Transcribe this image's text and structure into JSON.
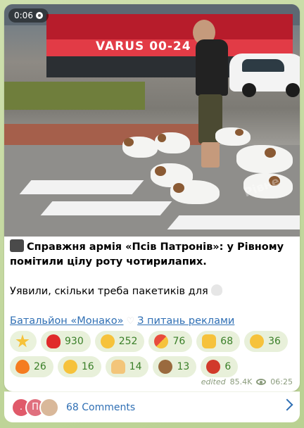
{
  "video": {
    "duration": "0:06",
    "store_sign": "VARUS 00-24",
    "watermark": "Рівне"
  },
  "post": {
    "title": "Справжня армія «Псів Патронів»: у Рівному помітили цілу роту чотирилапих.",
    "body": "Уявили, скільки треба пакетиків для",
    "link1": "Батальйон «Монако»",
    "link2": "З питань реклами"
  },
  "reactions": {
    "row1": [
      {
        "icon": "star-icon",
        "count": "",
        "color": "#f6c23b"
      },
      {
        "icon": "heart-on-fire-icon",
        "count": "930",
        "color": "#e02b2b"
      },
      {
        "icon": "smiling-face-hearts-icon",
        "count": "252",
        "color": "#f6c23b"
      },
      {
        "icon": "pill-icon",
        "count": "76",
        "color": "#e84b3c"
      },
      {
        "icon": "thumbs-up-icon",
        "count": "68",
        "color": "#f6c23b"
      },
      {
        "icon": "screaming-face-icon",
        "count": "36",
        "color": "#f6c23b"
      }
    ],
    "row2": [
      {
        "icon": "fire-icon",
        "count": "26",
        "color": "#f57c1f"
      },
      {
        "icon": "woozy-face-icon",
        "count": "16",
        "color": "#f6c23b"
      },
      {
        "icon": "folded-hands-icon",
        "count": "14",
        "color": "#f3c57a"
      },
      {
        "icon": "see-no-evil-monkey-icon",
        "count": "13",
        "color": "#9a6a3e"
      },
      {
        "icon": "cursing-face-icon",
        "count": "6",
        "color": "#d13a2b"
      }
    ]
  },
  "meta": {
    "edited": "edited",
    "views": "85.4K",
    "time": "06:25"
  },
  "comments": {
    "label": "68 Comments",
    "avatars": [
      {
        "letter": ".",
        "color": "#e05a6a"
      },
      {
        "letter": "П",
        "color": "#e0707e"
      },
      {
        "letter": "",
        "color": "#d9b89a"
      }
    ]
  }
}
